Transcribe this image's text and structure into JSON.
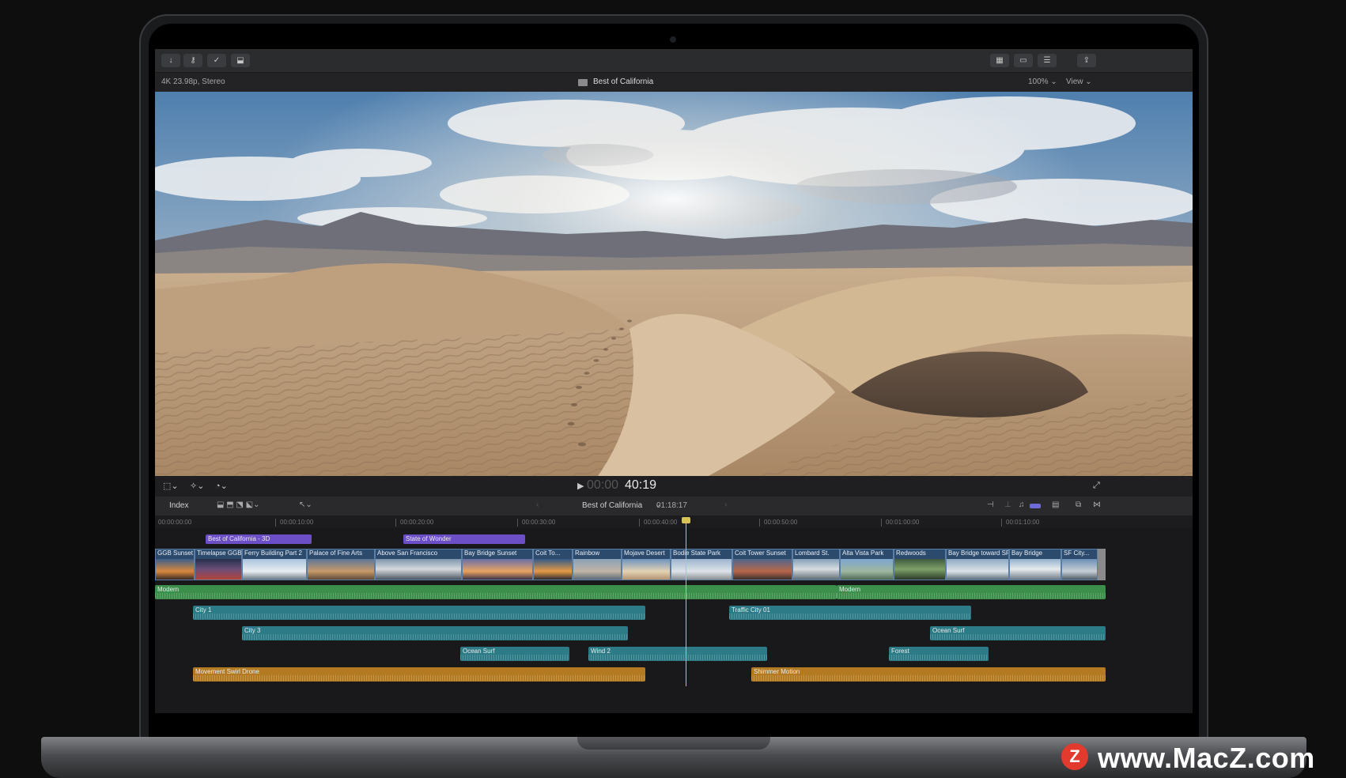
{
  "toolbar": {
    "icons": [
      "download-icon",
      "key-icon",
      "check-circle-icon",
      "tag-icon"
    ]
  },
  "infobar": {
    "format": "4K 23.98p, Stereo",
    "project": "Best of California",
    "zoom": "100%",
    "view": "View"
  },
  "transport": {
    "timecode_dim": "00:00",
    "timecode": "40:19"
  },
  "timeline_bar": {
    "index": "Index",
    "project": "Best of California",
    "duration": "01:18:17"
  },
  "ruler": [
    "00:00:00:00",
    "00:00:10:00",
    "00:00:20:00",
    "00:00:30:00",
    "00:00:40:00",
    "00:00:50:00",
    "00:01:00:00",
    "00:01:10:00"
  ],
  "titles": [
    "Best of California - 3D",
    "State of Wonder"
  ],
  "clips": [
    "GGB Sunset",
    "Timelapse GGB",
    "Ferry Building Part 2",
    "Palace of Fine Arts",
    "Above San Francisco",
    "Bay Bridge Sunset",
    "Coit To...",
    "Rainbow",
    "Mojave Desert",
    "Bodie State Park",
    "Coit Tower Sunset",
    "Lombard St.",
    "Alta Vista Park",
    "Redwoods",
    "Bay Bridge toward SF",
    "Bay Bridge",
    "SF City..."
  ],
  "music": [
    "Modern",
    "Modern"
  ],
  "audio": [
    "City 1",
    "Traffic City 01",
    "City 3",
    "Ocean Surf",
    "Ocean Surf",
    "Wind 2",
    "Forest"
  ],
  "effects": [
    "Movement Swirl Drone",
    "Shimmer Motion"
  ],
  "watermark": {
    "logo": "Z",
    "text": "www.MacZ.com"
  }
}
